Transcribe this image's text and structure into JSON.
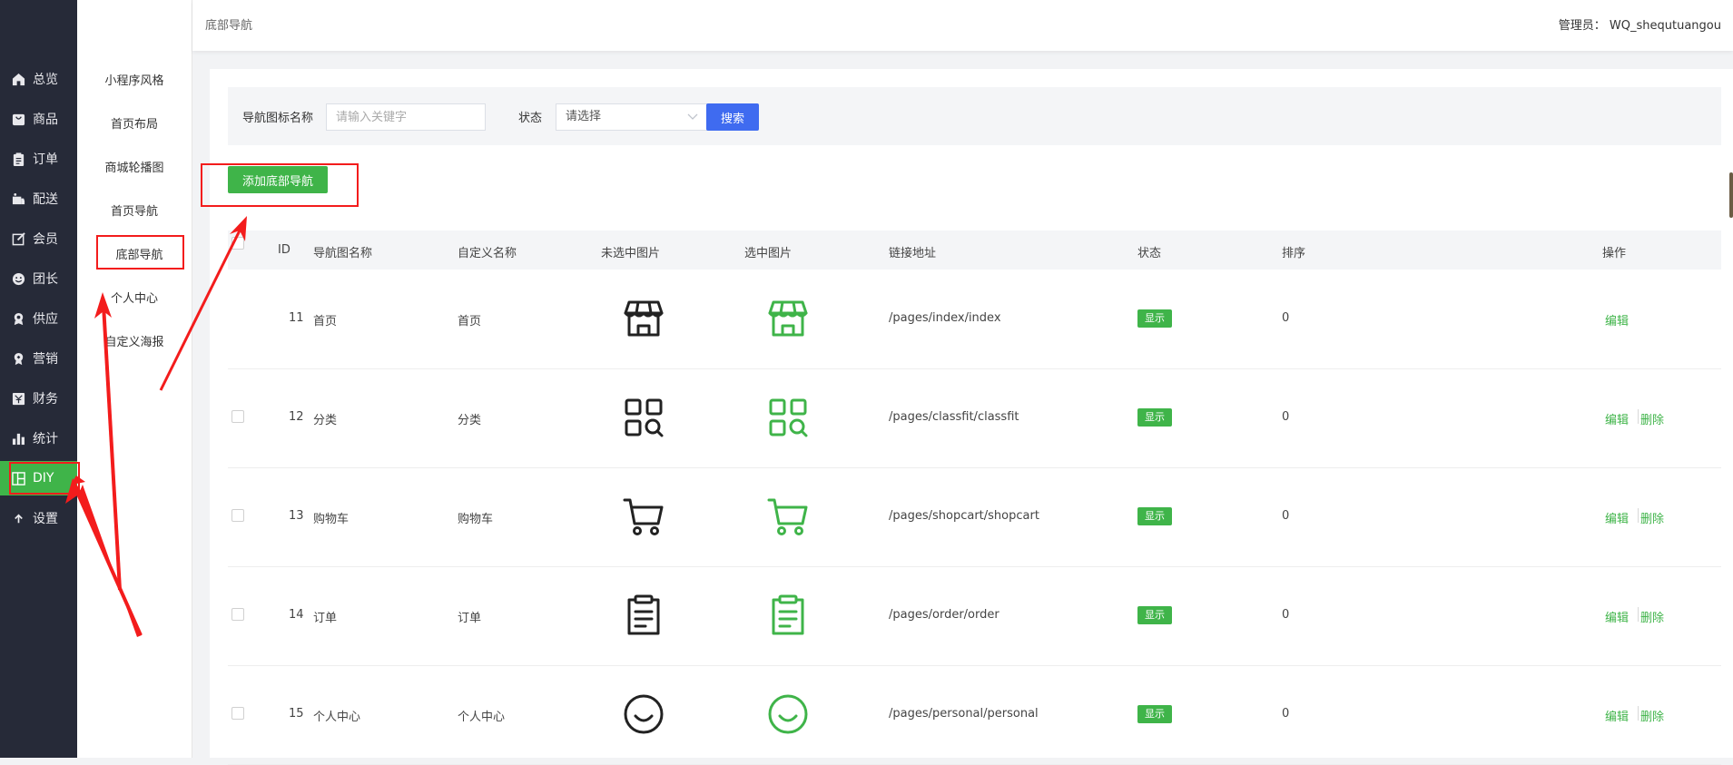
{
  "header": {
    "breadcrumb": "底部导航",
    "admin": "管理员： WQ_shequtuangou"
  },
  "sidebar": {
    "items": [
      {
        "label": "总览",
        "icon": "home-icon"
      },
      {
        "label": "商品",
        "icon": "bag-icon"
      },
      {
        "label": "订单",
        "icon": "clipboard-icon"
      },
      {
        "label": "配送",
        "icon": "delivery-icon"
      },
      {
        "label": "会员",
        "icon": "edit-icon"
      },
      {
        "label": "团长",
        "icon": "smile-icon"
      },
      {
        "label": "供应",
        "icon": "award-icon"
      },
      {
        "label": "营销",
        "icon": "ribbon-icon"
      },
      {
        "label": "财务",
        "icon": "finance-icon"
      },
      {
        "label": "统计",
        "icon": "bar-chart-icon"
      },
      {
        "label": "DIY",
        "icon": "layout-icon"
      },
      {
        "label": "设置",
        "icon": "arrow-up-icon"
      }
    ],
    "active_index": 10
  },
  "subnav": {
    "items": [
      "小程序风格",
      "首页布局",
      "商城轮播图",
      "首页导航",
      "底部导航",
      "个人中心",
      "自定义海报"
    ],
    "active_index": 4
  },
  "search": {
    "name_label": "导航图标名称",
    "name_placeholder": "请输入关键字",
    "status_label": "状态",
    "status_value": "请选择",
    "search_button": "搜索"
  },
  "add_button": "添加底部导航",
  "table": {
    "headers": [
      "ID",
      "导航图名称",
      "自定义名称",
      "未选中图片",
      "选中图片",
      "链接地址",
      "状态",
      "排序",
      "操作"
    ],
    "rows": [
      {
        "id": "11",
        "name": "首页",
        "custom": "首页",
        "icon": "store",
        "link": "/pages/index/index",
        "status": "显示",
        "sort": "0",
        "actions": [
          "编辑"
        ]
      },
      {
        "id": "12",
        "name": "分类",
        "custom": "分类",
        "icon": "category",
        "link": "/pages/classfit/classfit",
        "status": "显示",
        "sort": "0",
        "actions": [
          "编辑",
          "删除"
        ]
      },
      {
        "id": "13",
        "name": "购物车",
        "custom": "购物车",
        "icon": "cart",
        "link": "/pages/shopcart/shopcart",
        "status": "显示",
        "sort": "0",
        "actions": [
          "编辑",
          "删除"
        ]
      },
      {
        "id": "14",
        "name": "订单",
        "custom": "订单",
        "icon": "order",
        "link": "/pages/order/order",
        "status": "显示",
        "sort": "0",
        "actions": [
          "编辑",
          "删除"
        ]
      },
      {
        "id": "15",
        "name": "个人中心",
        "custom": "个人中心",
        "icon": "smile",
        "link": "/pages/personal/personal",
        "status": "显示",
        "sort": "0",
        "actions": [
          "编辑",
          "删除"
        ]
      }
    ]
  },
  "colors": {
    "sidebar_bg": "#262a38",
    "accent_green": "#3fb449",
    "search_blue": "#3f6bf0",
    "annotation_red": "#f31c1c",
    "icon_dark": "#222222"
  }
}
